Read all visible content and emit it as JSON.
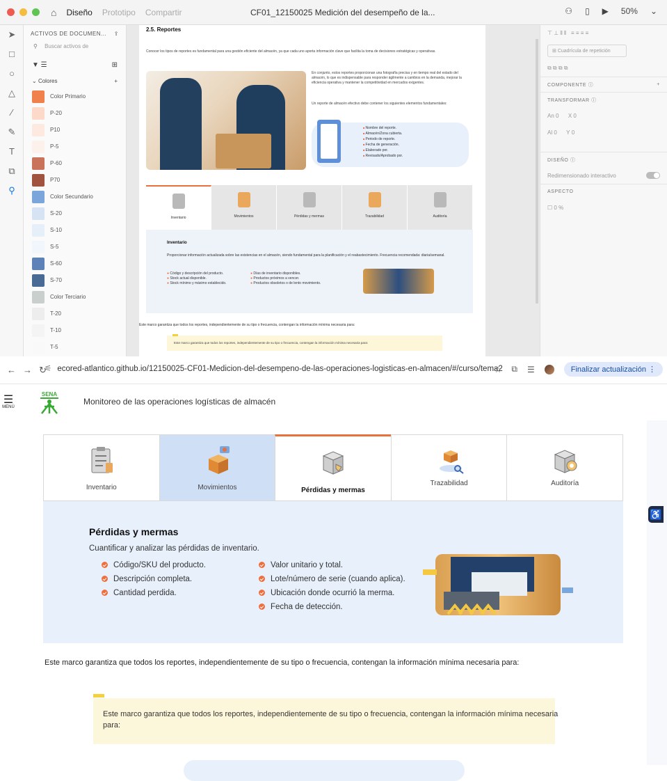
{
  "xd": {
    "tabs": [
      "Diseño",
      "Prototipo",
      "Compartir"
    ],
    "active_tab": "Diseño",
    "doc_title": "CF01_12150025 Medición del desempeño de la...",
    "zoom": "50%",
    "assets": {
      "header": "ACTIVOS DE DOCUMEN...",
      "search_placeholder": "Buscar activos de",
      "colors_label": "Colores",
      "swatches": [
        {
          "name": "Color Primario",
          "color": "#f0814c"
        },
        {
          "name": "P-20",
          "color": "#fcd9c8"
        },
        {
          "name": "P10",
          "color": "#fde9df"
        },
        {
          "name": "P-5",
          "color": "#fdf1eb"
        },
        {
          "name": "P-60",
          "color": "#c8735a"
        },
        {
          "name": "P70",
          "color": "#a0533e"
        },
        {
          "name": "Color Secundario",
          "color": "#7aa6dc"
        },
        {
          "name": "S-20",
          "color": "#d5e3f5"
        },
        {
          "name": "S-10",
          "color": "#e6eefa"
        },
        {
          "name": "S-5",
          "color": "#f1f6fc"
        },
        {
          "name": "S-60",
          "color": "#5d82b8"
        },
        {
          "name": "S-70",
          "color": "#4a6a96"
        },
        {
          "name": "Color Terciario",
          "color": "#c9cfcc"
        },
        {
          "name": "T-20",
          "color": "#ededed"
        },
        {
          "name": "T-10",
          "color": "#f4f4f4"
        },
        {
          "name": "T-5",
          "color": "#f9f9f9"
        }
      ]
    },
    "artboard": {
      "section_title": "2.5. Reportes",
      "intro": "Conocer los tipos de reportes es fundamental para una gestión eficiente del almacén, ya que cada uno aporta información clave que facilita la toma de decisiones estratégicas y operativas.",
      "right_text": "En conjunto, estos reportes proporcionan una fotografía precisa y en tiempo real del estado del almacén, lo que es indispensable para responder ágilmente a cambios en la demanda, mejorar la eficiencia operativa y mantener la competitividad en mercados exigentes.",
      "right_text2": "Un reporte de almacén efectivo debe contener los siguientes elementos fundamentales:",
      "clip_items": [
        "Nombre del reporte.",
        "Almacén/Zona cubierta.",
        "Periodo de reporte.",
        "Fecha de generación.",
        "Elaborado por.",
        "Revisado/Aprobado por."
      ],
      "tabs": [
        "Inventario",
        "Movimientos",
        "Pérdidas y mermas",
        "Trazabilidad",
        "Auditoría"
      ],
      "panel_title": "Inventario",
      "panel_desc": "Proporcionar información actualizada sobre las existencias en el almacén, siendo fundamental para la planificación y el reabastecimiento. Frecuencia recomendada: diaria/semanal.",
      "col1": [
        "Código y descripción del producto.",
        "Stock actual disponible.",
        "Stock mínimo y máximo establecido."
      ],
      "col2": [
        "Días de inventario disponibles.",
        "Productos próximos a vencer.",
        "Productos obsoletos o de lento movimiento."
      ],
      "footer": "Este marco garantiza que todos los reportes, independientemente de su tipo o frecuencia, contengan la información mínima necesaria para:",
      "callout": "Este marco garantiza que todos los reportes, independientemente de su tipo o frecuencia, contengan la información mínima necesaria para:"
    },
    "props": {
      "repeat_grid": "Cuadrícula de repetición",
      "component": "COMPONENTE",
      "transform": "TRANSFORMAR",
      "w_label": "An",
      "w_val": "0",
      "x_label": "X",
      "x_val": "0",
      "h_label": "Al",
      "h_val": "0",
      "y_label": "Y",
      "y_val": "0",
      "design": "DISEÑO",
      "responsive": "Redimensionado interactivo",
      "appearance": "ASPECTO",
      "opacity": "0 %"
    }
  },
  "browser": {
    "url": "ecored-atlantico.github.io/12150025-CF01-Medicion-del-desempeno-de-las-operaciones-logisticas-en-almacen/#/curso/tema2",
    "update_button": "Finalizar actualización"
  },
  "site": {
    "menu_label": "MENÚ",
    "logo_text": "SENA",
    "title": "Monitoreo de las operaciones logísticas de almacén",
    "tabs": [
      {
        "label": "Inventario",
        "icon": "clipboard-icon"
      },
      {
        "label": "Movimientos",
        "icon": "boxes-icon"
      },
      {
        "label": "Pérdidas y mermas",
        "icon": "damaged-box-icon"
      },
      {
        "label": "Trazabilidad",
        "icon": "tracking-icon"
      },
      {
        "label": "Auditoría",
        "icon": "audit-icon"
      }
    ],
    "selected_tab": "Pérdidas y mermas",
    "hover_tab": "Movimientos",
    "panel": {
      "title": "Pérdidas y mermas",
      "description": "Cuantificar y analizar las pérdidas de inventario.",
      "col1": [
        "Código/SKU del producto.",
        "Descripción completa.",
        "Cantidad perdida."
      ],
      "col2": [
        "Valor unitario y total.",
        "Lote/número de serie (cuando aplica).",
        "Ubicación donde ocurrió la merma.",
        "Fecha de detección."
      ]
    },
    "below_text": "Este marco garantiza que todos los reportes, independientemente de su tipo o frecuencia, contengan la información mínima necesaria para:",
    "callout": "Este marco garantiza que todos los reportes, independientemente de su tipo o frecuencia, contengan la información mínima necesaria para:",
    "colors": {
      "accent": "#ef6f3c",
      "panel_bg": "#e8f0fb",
      "hover_tab": "#cfe0f6",
      "callout_bg": "#fcf6da",
      "sena_green": "#39a935"
    }
  }
}
